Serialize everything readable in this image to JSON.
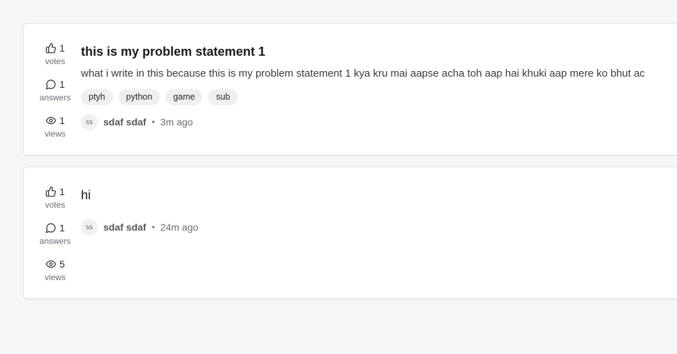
{
  "questions": [
    {
      "votes": "1",
      "votes_label": "votes",
      "answers": "1",
      "answers_label": "answers",
      "views": "1",
      "views_label": "views",
      "title": "this is my problem statement 1",
      "excerpt": "what i write in this because this is my problem statement 1 kya kru mai aapse acha toh aap hai khuki aap mere ko bhut ac",
      "tags": [
        "ptyh",
        "python",
        "game",
        "sub"
      ],
      "avatar_initials": "ss",
      "author": "sdaf sdaf",
      "separator": "•",
      "time": "3m ago"
    },
    {
      "votes": "1",
      "votes_label": "votes",
      "answers": "1",
      "answers_label": "answers",
      "views": "5",
      "views_label": "views",
      "title": "hi",
      "avatar_initials": "ss",
      "author": "sdaf sdaf",
      "separator": "•",
      "time": "24m ago"
    }
  ],
  "icons": {
    "votes": "thumbs-up-icon",
    "answers": "chat-bubble-icon",
    "views": "eye-icon"
  }
}
